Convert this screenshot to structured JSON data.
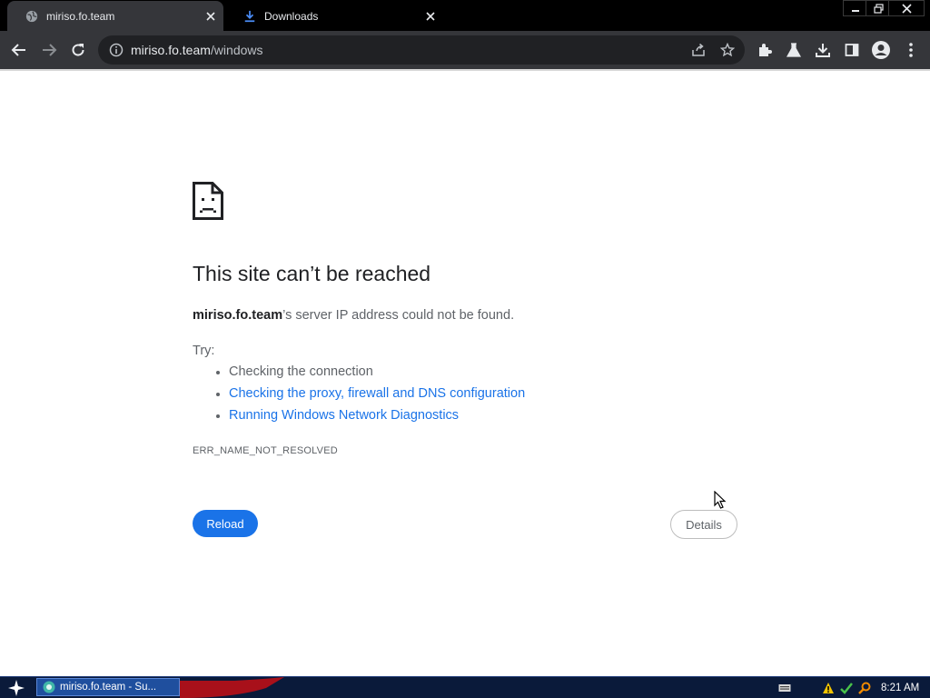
{
  "browser": {
    "tabs": [
      {
        "label": "miriso.fo.team",
        "active": true
      },
      {
        "label": "Downloads",
        "active": false
      }
    ],
    "url": {
      "host": "miriso.fo.team",
      "path": "/windows"
    }
  },
  "page": {
    "heading": "This site can’t be reached",
    "message_host": "miriso.fo.team",
    "message_rest": "’s server IP address could not be found.",
    "try_label": "Try:",
    "suggestions": [
      "Checking the connection",
      "Checking the proxy, firewall and DNS configuration",
      "Running Windows Network Diagnostics"
    ],
    "error_code": "ERR_NAME_NOT_RESOLVED",
    "reload_label": "Reload",
    "details_label": "Details"
  },
  "taskbar": {
    "task_label": "miriso.fo.team - Su...",
    "clock": "8:21 AM"
  },
  "colors": {
    "link": "#1a73e8",
    "reload_button": "#1a73e8",
    "toolbar": "#35363a",
    "titlebar": "#000000"
  }
}
